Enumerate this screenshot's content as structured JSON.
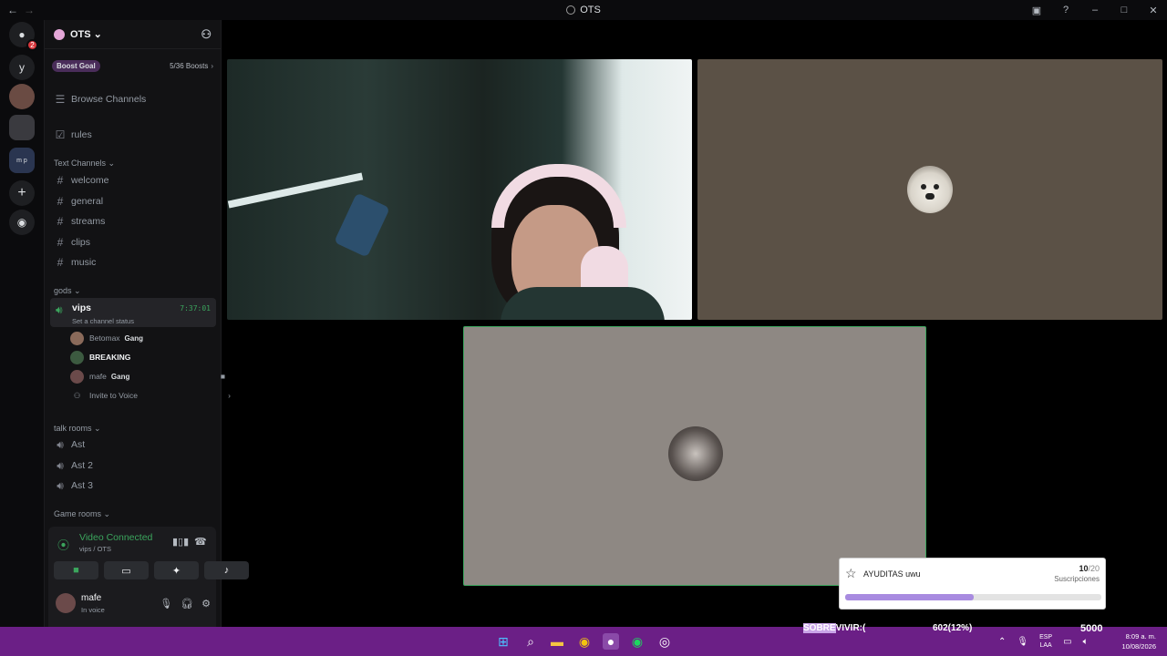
{
  "window": {
    "title": "OTS"
  },
  "server": {
    "name": "OTS",
    "boost_label": "Boost Goal",
    "boost_count": "5/36 Boosts"
  },
  "nav": {
    "browse": "Browse Channels",
    "rules": "rules"
  },
  "categories": {
    "text": "Text Channels",
    "gods": "gods",
    "talk": "talk rooms",
    "game": "Game rooms"
  },
  "text_channels": [
    "welcome",
    "general",
    "streams",
    "clips",
    "music"
  ],
  "voice": {
    "name": "vips",
    "status": "Set a channel status",
    "time": "7:37:01"
  },
  "voice_users": [
    {
      "name": "Betomax",
      "tag": "Gang"
    },
    {
      "name": "BREAKING",
      "tag": ""
    },
    {
      "name": "mafe",
      "tag": "Gang"
    }
  ],
  "invite": "Invite to Voice",
  "talk_rooms": [
    "Ast",
    "Ast 2",
    "Ast 3"
  ],
  "connection": {
    "title": "Video Connected",
    "sub": "vips / OTS"
  },
  "user": {
    "name": "mafe",
    "status": "In voice"
  },
  "rail": {
    "dm_badge": "2",
    "letter": "y",
    "folder_text": "m p"
  },
  "goal": {
    "title": "AYUDITAS uwu",
    "current": "10",
    "total": "/20",
    "label": "Suscripciones",
    "progress": 0.5
  },
  "overlay": {
    "left_hl": "SOBRE",
    "left_rest": "VIVIR:(",
    "mid": "602(12%)",
    "right": "5000"
  },
  "taskbar": {
    "lang_top": "ESP",
    "lang_bottom": "LAA",
    "time": "8:09 a. m.",
    "date": "10/08/2026"
  },
  "colors": {
    "accent_green": "#3ba55d",
    "taskbar": "#6b1f86",
    "goal_fill": "#a88be0"
  }
}
